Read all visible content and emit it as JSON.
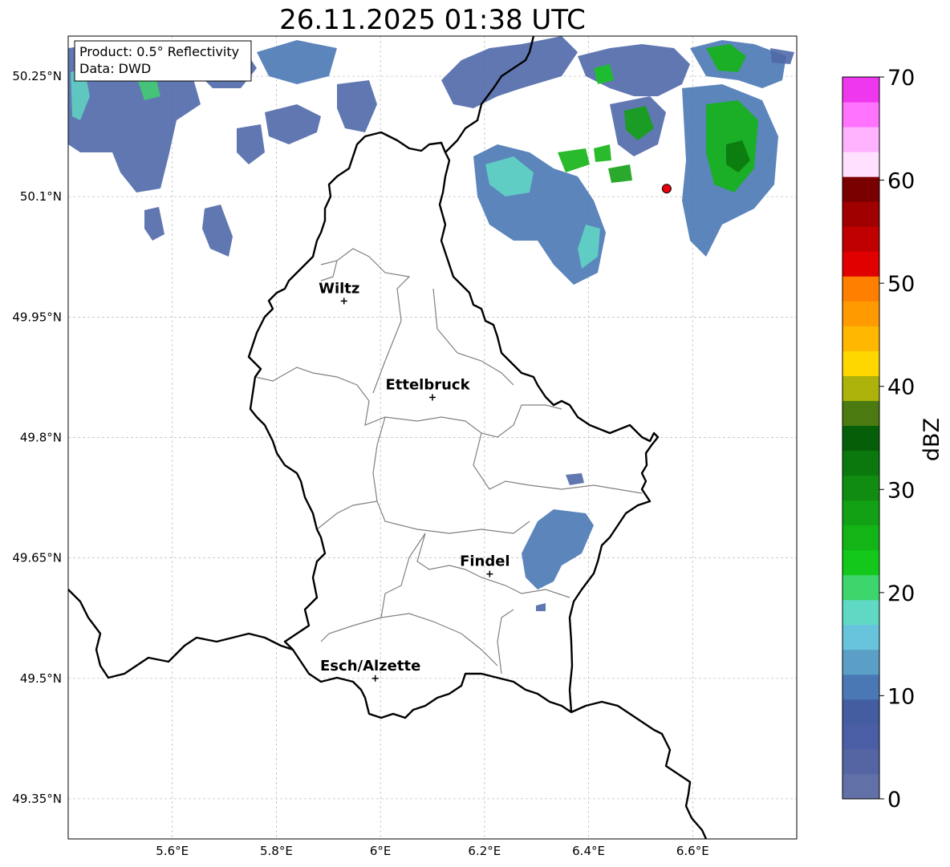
{
  "title": "26.11.2025 01:38 UTC",
  "info_box": {
    "product": "Product: 0.5° Reflectivity",
    "source": "Data: DWD"
  },
  "axes": {
    "lon_ticks": [
      "5.6°E",
      "5.8°E",
      "6°E",
      "6.2°E",
      "6.4°E",
      "6.6°E"
    ],
    "lat_ticks": [
      "50.25°N",
      "50.1°N",
      "49.95°N",
      "49.8°N",
      "49.65°N",
      "49.5°N",
      "49.35°N"
    ],
    "lon_range": [
      5.4,
      6.8
    ],
    "lat_range": [
      49.3,
      50.3
    ],
    "grid": true
  },
  "cities": [
    {
      "name": "Wiltz",
      "lon": 5.93,
      "lat": 49.97
    },
    {
      "name": "Ettelbruck",
      "lon": 6.1,
      "lat": 49.85
    },
    {
      "name": "Findel",
      "lon": 6.21,
      "lat": 49.63
    },
    {
      "name": "Esch/Alzette",
      "lon": 5.99,
      "lat": 49.5
    }
  ],
  "radar_site": {
    "lon": 6.55,
    "lat": 50.11,
    "color": "#e8000b"
  },
  "colorbar": {
    "label": "dBZ",
    "ticks": [
      "0",
      "10",
      "20",
      "30",
      "40",
      "50",
      "60",
      "70"
    ],
    "range": [
      0,
      70
    ],
    "colors": [
      "#6270a8",
      "#5565a4",
      "#4a5ea6",
      "#435da0",
      "#4a78b4",
      "#5b9ec6",
      "#67c4dc",
      "#5fd9c4",
      "#3dd66c",
      "#13c81a",
      "#13b416",
      "#12a014",
      "#108c10",
      "#0b780d",
      "#065f08",
      "#4a7a10",
      "#adb30a",
      "#ffd700",
      "#ffb700",
      "#ff9a00",
      "#ff7f00",
      "#e00000",
      "#c00000",
      "#a00000",
      "#7a0000",
      "#ffe0ff",
      "#ffb3ff",
      "#ff73ff",
      "#ee37ee"
    ]
  },
  "map_layers": {
    "country_border_color": "#000000",
    "canton_border_color": "#808080"
  }
}
